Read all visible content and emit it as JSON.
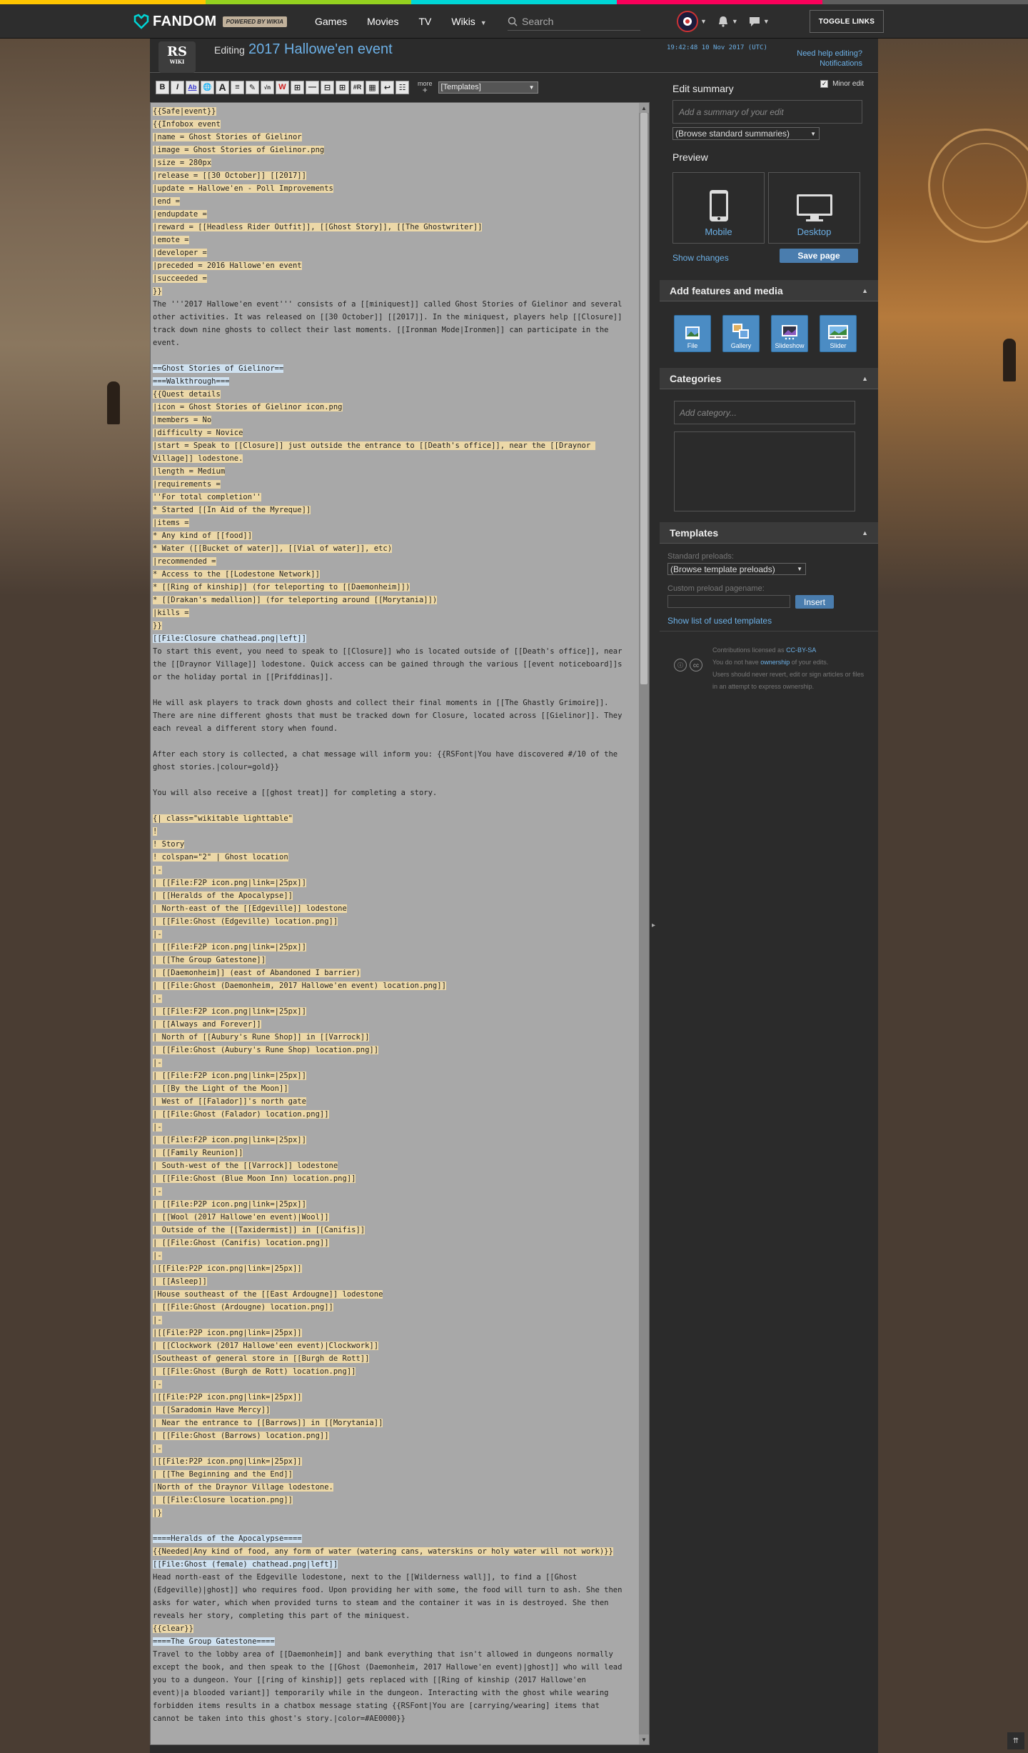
{
  "accent_colors": [
    "#ffc500",
    "#94d11f",
    "#00d6d6",
    "#fa005a",
    "#5e5e5e"
  ],
  "global_nav": {
    "logo_text": "FANDOM",
    "powered_by": "POWERED BY WIKIA",
    "links": [
      "Games",
      "Movies",
      "TV",
      "Wikis"
    ],
    "search_placeholder": "Search",
    "toggle_links": "TOGGLE LINKS"
  },
  "edit_header": {
    "wiki_logo_text": "RS",
    "wiki_logo_sub": "WIKI",
    "editing_label": "Editing",
    "page_title": "2017 Hallowe'en event",
    "timestamp": "19:42:48 10 Nov 2017 (UTC)",
    "help_link": "Need help editing?",
    "notifications_link": "Notifications"
  },
  "toolbar": {
    "buttons": [
      "B",
      "I",
      "Ab",
      "🌐",
      "A",
      "≡",
      "✎",
      "√n",
      "W",
      "⊞",
      "—",
      "⊟",
      "⊞",
      "#R",
      "▦",
      "↩",
      "☷"
    ],
    "more_label": "more",
    "plus_label": "+",
    "templates_select": "[Templates]"
  },
  "editor_lines": [
    {
      "t": "{{Safe|event}}",
      "h": "t"
    },
    {
      "t": "{{Infobox event",
      "h": "t"
    },
    {
      "t": "|name = Ghost Stories of Gielinor",
      "h": "t"
    },
    {
      "t": "|image = Ghost Stories of Gielinor.png",
      "h": "t"
    },
    {
      "t": "|size = 280px",
      "h": "t"
    },
    {
      "t": "|release = [[30 October]] [[2017]]",
      "h": "t"
    },
    {
      "t": "|update = Hallowe'en - Poll Improvements",
      "h": "t"
    },
    {
      "t": "|end =",
      "h": "t"
    },
    {
      "t": "|endupdate =",
      "h": "t"
    },
    {
      "t": "|reward = [[Headless Rider Outfit]], [[Ghost Story]], [[The Ghostwriter]]",
      "h": "t"
    },
    {
      "t": "|emote =",
      "h": "t"
    },
    {
      "t": "|developer =",
      "h": "t"
    },
    {
      "t": "|preceded = 2016 Hallowe'en event",
      "h": "t"
    },
    {
      "t": "|succeeded =",
      "h": "t"
    },
    {
      "t": "}}",
      "h": "t"
    },
    {
      "t": "The '''2017 Hallowe'en event''' consists of a [[miniquest]] called Ghost Stories of Gielinor and several other activities. It was released on [[30 October]] [[2017]]. In the miniquest, players help [[Closure]] track down nine ghosts to collect their last moments. [[Ironman Mode|Ironmen]] can participate in the event.",
      "h": ""
    },
    {
      "t": "",
      "h": ""
    },
    {
      "t": "==Ghost Stories of Gielinor==",
      "h": "l"
    },
    {
      "t": "===Walkthrough===",
      "h": "l"
    },
    {
      "t": "{{Quest details",
      "h": "t"
    },
    {
      "t": "|icon = Ghost Stories of Gielinor icon.png",
      "h": "t"
    },
    {
      "t": "|members = No",
      "h": "t"
    },
    {
      "t": "|difficulty = Novice",
      "h": "t"
    },
    {
      "t": "|start = Speak to [[Closure]] just outside the entrance to [[Death's office]], near the [[Draynor Village]] lodestone.",
      "h": "t"
    },
    {
      "t": "|length = Medium",
      "h": "t"
    },
    {
      "t": "|requirements =",
      "h": "t"
    },
    {
      "t": "''For total completion''",
      "h": "t"
    },
    {
      "t": "* Started [[In Aid of the Myreque]]",
      "h": "t"
    },
    {
      "t": "|items =",
      "h": "t"
    },
    {
      "t": "* Any kind of [[food]]",
      "h": "t"
    },
    {
      "t": "* Water ([[Bucket of water]], [[Vial of water]], etc)",
      "h": "t"
    },
    {
      "t": "|recommended =",
      "h": "t"
    },
    {
      "t": "* Access to the [[Lodestone Network]]",
      "h": "t"
    },
    {
      "t": "* [[Ring of kinship]] (for teleporting to [[Daemonheim]])",
      "h": "t"
    },
    {
      "t": "* [[Drakan's medallion]] (for teleporting around [[Morytania]])",
      "h": "t"
    },
    {
      "t": "|kills =",
      "h": "t"
    },
    {
      "t": "}}",
      "h": "t"
    },
    {
      "t": "[[File:Closure chathead.png|left]]",
      "h": "l"
    },
    {
      "t": "To start this event, you need to speak to [[Closure]] who is located outside of [[Death's office]], near the [[Draynor Village]] lodestone. Quick access can be gained through the various [[event noticeboard]]s or the holiday portal in [[Prifddinas]].",
      "h": ""
    },
    {
      "t": "",
      "h": ""
    },
    {
      "t": "He will ask players to track down ghosts and collect their final moments in [[The Ghastly Grimoire]]. There are nine different ghosts that must be tracked down for Closure, located across [[Gielinor]]. They each reveal a different story when found.",
      "h": ""
    },
    {
      "t": "",
      "h": ""
    },
    {
      "t": "After each story is collected, a chat message will inform you: {{RSFont|You have discovered #/10 of the ghost stories.|colour=gold}}",
      "h": ""
    },
    {
      "t": "",
      "h": ""
    },
    {
      "t": "You will also receive a [[ghost treat]] for completing a story.",
      "h": ""
    },
    {
      "t": "",
      "h": ""
    },
    {
      "t": "{| class=\"wikitable lighttable\"",
      "h": "t"
    },
    {
      "t": "!",
      "h": "t"
    },
    {
      "t": "! Story",
      "h": "t"
    },
    {
      "t": "! colspan=\"2\" | Ghost location",
      "h": "t"
    },
    {
      "t": "|-",
      "h": "t"
    },
    {
      "t": "| [[File:F2P icon.png|link=|25px]]",
      "h": "t"
    },
    {
      "t": "| [[Heralds of the Apocalypse]]",
      "h": "t"
    },
    {
      "t": "| North-east of the [[Edgeville]] lodestone",
      "h": "t"
    },
    {
      "t": "| [[File:Ghost (Edgeville) location.png]]",
      "h": "t"
    },
    {
      "t": "|-",
      "h": "t"
    },
    {
      "t": "| [[File:F2P icon.png|link=|25px]]",
      "h": "t"
    },
    {
      "t": "| [[The Group Gatestone]]",
      "h": "t"
    },
    {
      "t": "| [[Daemonheim]] (east of Abandoned I barrier)",
      "h": "t"
    },
    {
      "t": "| [[File:Ghost (Daemonheim, 2017 Hallowe'en event) location.png]]",
      "h": "t"
    },
    {
      "t": "|-",
      "h": "t"
    },
    {
      "t": "| [[File:F2P icon.png|link=|25px]]",
      "h": "t"
    },
    {
      "t": "| [[Always and Forever]]",
      "h": "t"
    },
    {
      "t": "| North of [[Aubury's Rune Shop]] in [[Varrock]]",
      "h": "t"
    },
    {
      "t": "| [[File:Ghost (Aubury's Rune Shop) location.png]]",
      "h": "t"
    },
    {
      "t": "|-",
      "h": "t"
    },
    {
      "t": "| [[File:F2P icon.png|link=|25px]]",
      "h": "t"
    },
    {
      "t": "| [[By the Light of the Moon]]",
      "h": "t"
    },
    {
      "t": "| West of [[Falador]]'s north gate",
      "h": "t"
    },
    {
      "t": "| [[File:Ghost (Falador) location.png]]",
      "h": "t"
    },
    {
      "t": "|-",
      "h": "t"
    },
    {
      "t": "| [[File:F2P icon.png|link=|25px]]",
      "h": "t"
    },
    {
      "t": "| [[Family Reunion]]",
      "h": "t"
    },
    {
      "t": "| South-west of the [[Varrock]] lodestone",
      "h": "t"
    },
    {
      "t": "| [[File:Ghost (Blue Moon Inn) location.png]]",
      "h": "t"
    },
    {
      "t": "|-",
      "h": "t"
    },
    {
      "t": "| [[File:P2P icon.png|link=|25px]]",
      "h": "t"
    },
    {
      "t": "| [[Wool (2017 Hallowe'en event)|Wool]]",
      "h": "t"
    },
    {
      "t": "| Outside of the [[Taxidermist]] in [[Canifis]]",
      "h": "t"
    },
    {
      "t": "| [[File:Ghost (Canifis) location.png]]",
      "h": "t"
    },
    {
      "t": "|-",
      "h": "t"
    },
    {
      "t": "|[[File:P2P icon.png|link=|25px]]",
      "h": "t"
    },
    {
      "t": "| [[Asleep]]",
      "h": "t"
    },
    {
      "t": "|House southeast of the [[East Ardougne]] lodestone",
      "h": "t"
    },
    {
      "t": "| [[File:Ghost (Ardougne) location.png]]",
      "h": "t"
    },
    {
      "t": "|-",
      "h": "t"
    },
    {
      "t": "|[[File:P2P icon.png|link=|25px]]",
      "h": "t"
    },
    {
      "t": "| [[Clockwork (2017 Hallowe'een event)|Clockwork]]",
      "h": "t"
    },
    {
      "t": "|Southeast of general store in [[Burgh de Rott]]",
      "h": "t"
    },
    {
      "t": "| [[File:Ghost (Burgh de Rott) location.png]]",
      "h": "t"
    },
    {
      "t": "|-",
      "h": "t"
    },
    {
      "t": "|[[File:P2P icon.png|link=|25px]]",
      "h": "t"
    },
    {
      "t": "| [[Saradomin Have Mercy]]",
      "h": "t"
    },
    {
      "t": "| Near the entrance to [[Barrows]] in [[Morytania]]",
      "h": "t"
    },
    {
      "t": "| [[File:Ghost (Barrows) location.png]]",
      "h": "t"
    },
    {
      "t": "|-",
      "h": "t"
    },
    {
      "t": "|[[File:P2P icon.png|link=|25px]]",
      "h": "t"
    },
    {
      "t": "| [[The Beginning and the End]]",
      "h": "t"
    },
    {
      "t": "|North of the Draynor Village lodestone.",
      "h": "t"
    },
    {
      "t": "| [[File:Closure location.png]]",
      "h": "t"
    },
    {
      "t": "|}",
      "h": "t"
    },
    {
      "t": "",
      "h": ""
    },
    {
      "t": "====Heralds of the Apocalypse====",
      "h": "l"
    },
    {
      "t": "{{Needed|Any kind of food, any form of water (watering cans, waterskins or holy water will not work)}}",
      "h": "t"
    },
    {
      "t": "[[File:Ghost (female) chathead.png|left]]",
      "h": "l"
    },
    {
      "t": "Head north-east of the Edgeville lodestone, next to the [[Wilderness wall]], to find a [[Ghost (Edgeville)|ghost]] who requires food. Upon providing her with some, the food will turn to ash. She then asks for water, which when provided turns to steam and the container it was in is destroyed. She then reveals her story, completing this part of the miniquest.",
      "h": ""
    },
    {
      "t": "{{clear}}",
      "h": "t"
    },
    {
      "t": "====The Group Gatestone====",
      "h": "l"
    },
    {
      "t": "Travel to the lobby area of [[Daemonheim]] and bank everything that isn't allowed in dungeons normally except the book, and then speak to the [[Ghost (Daemonheim, 2017 Hallowe'en event)|ghost]] who will lead you to a dungeon. Your [[ring of kinship]] gets replaced with [[Ring of kinship (2017 Hallowe'en event)|a blooded variant]] temporarily while in the dungeon. Interacting with the ghost while wearing forbidden items results in a chatbox message stating {{RSFont|You are [carrying/wearing] items that cannot be taken into this ghost's story.|color=#AE0000}}",
      "h": ""
    }
  ],
  "right_rail": {
    "edit_summary_label": "Edit summary",
    "minor_edit_label": "Minor edit",
    "summary_placeholder": "Add a summary of your edit",
    "summary_select": "(Browse standard summaries)",
    "preview_label": "Preview",
    "mobile_label": "Mobile",
    "desktop_label": "Desktop",
    "show_changes": "Show changes",
    "save_page": "Save page",
    "features_header": "Add features and media",
    "features": [
      "File",
      "Gallery",
      "Slideshow",
      "Slider"
    ],
    "categories_header": "Categories",
    "category_placeholder": "Add category...",
    "templates_header": "Templates",
    "standard_preloads_label": "Standard preloads:",
    "preload_select": "(Browse template preloads)",
    "custom_preload_label": "Custom preload pagename:",
    "insert_button": "Insert",
    "show_templates_link": "Show list of used templates",
    "license_pre": "Contributions licensed as ",
    "license_link": "CC-BY-SA",
    "license_line2_pre": "You do not have ",
    "license_line2_link": "ownership",
    "license_line2_post": " of your edits.",
    "license_line3": "Users should never revert, edit or sign articles or files in an attempt to express ownership."
  }
}
